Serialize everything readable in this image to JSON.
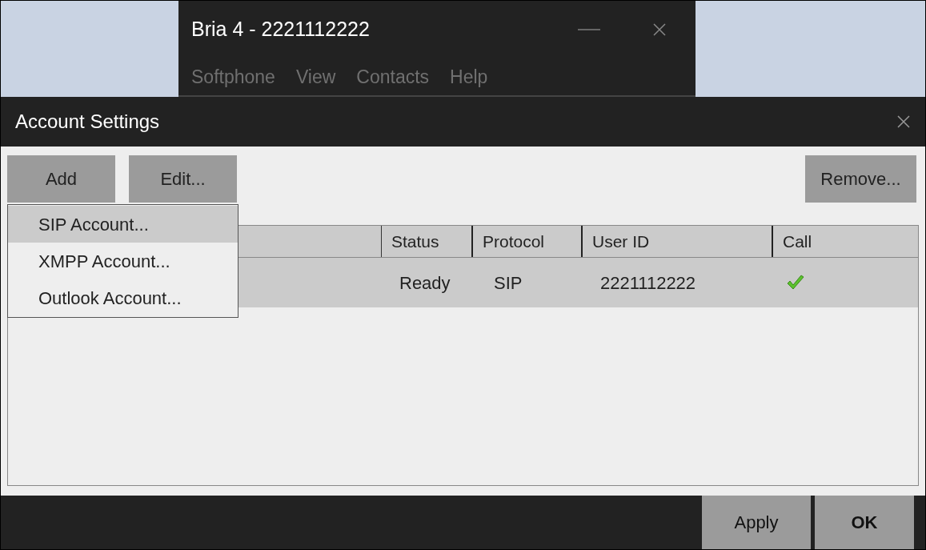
{
  "main_window": {
    "title": "Bria 4 - 2221112222",
    "menu": [
      "Softphone",
      "View",
      "Contacts",
      "Help"
    ]
  },
  "dialog": {
    "title": "Account Settings",
    "toolbar": {
      "left": [
        "Add",
        "Edit..."
      ],
      "right": "Remove..."
    },
    "add_menu": [
      {
        "label": "SIP Account...",
        "selected": true
      },
      {
        "label": "XMPP Account...",
        "selected": false
      },
      {
        "label": "Outlook Account...",
        "selected": false
      }
    ],
    "table": {
      "columns": [
        "Status",
        "Protocol",
        "User ID",
        "Call"
      ],
      "rows": [
        {
          "status": "Ready",
          "protocol": "SIP",
          "user_id": "2221112222",
          "call_enabled": true,
          "selected": true
        }
      ]
    },
    "buttons": [
      {
        "label": "Apply",
        "kind": "normal"
      },
      {
        "label": "OK",
        "kind": "default"
      }
    ]
  }
}
